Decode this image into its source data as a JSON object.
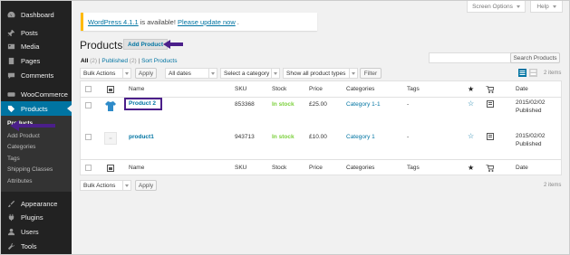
{
  "sidebar": {
    "items": [
      {
        "label": "Dashboard",
        "icon": "dashboard-icon"
      },
      {
        "label": "Posts",
        "icon": "pin-icon"
      },
      {
        "label": "Media",
        "icon": "media-icon"
      },
      {
        "label": "Pages",
        "icon": "page-icon"
      },
      {
        "label": "Comments",
        "icon": "comment-icon"
      },
      {
        "label": "WooCommerce",
        "icon": "woocommerce-icon"
      },
      {
        "label": "Products",
        "icon": "products-icon"
      },
      {
        "label": "Appearance",
        "icon": "brush-icon"
      },
      {
        "label": "Plugins",
        "icon": "plug-icon"
      },
      {
        "label": "Users",
        "icon": "user-icon"
      },
      {
        "label": "Tools",
        "icon": "wrench-icon"
      }
    ],
    "submenu": [
      "Products",
      "Add Product",
      "Categories",
      "Tags",
      "Shipping Classes",
      "Attributes"
    ]
  },
  "header": {
    "screen_options": "Screen Options",
    "help": "Help",
    "notice": {
      "prefix": "WordPress 4.1.1",
      "mid": "is available!",
      "link": "Please update now",
      "suffix": "."
    },
    "title": "Products",
    "add_new": "Add Product"
  },
  "views": {
    "all": "All",
    "all_count": "(2)",
    "published": "Published",
    "published_count": "(2)",
    "sort": "Sort Products",
    "sep": "|"
  },
  "search": {
    "button": "Search Products",
    "value": ""
  },
  "filters": {
    "bulk_actions": "Bulk Actions",
    "apply": "Apply",
    "dates": "All dates",
    "category": "Select a category",
    "product_types": "Show all product types",
    "filter": "Filter"
  },
  "items_count": "2 items",
  "columns": {
    "name": "Name",
    "sku": "SKU",
    "stock": "Stock",
    "price": "Price",
    "categories": "Categories",
    "tags": "Tags",
    "date": "Date"
  },
  "rows": [
    {
      "name": "Product 2",
      "sku": "853368",
      "stock": "In stock",
      "price": "£25.00",
      "category": "Category 1-1",
      "tags": "-",
      "date": "2015/02/02",
      "status": "Published"
    },
    {
      "name": "product1",
      "sku": "943713",
      "stock": "In stock",
      "price": "£10.00",
      "category": "Category 1",
      "tags": "-",
      "date": "2015/02/02",
      "status": "Published"
    }
  ],
  "colors": {
    "sidebar": "#222222",
    "active": "#0074a2",
    "link": "#0074a2",
    "annotation": "#4b1f8a",
    "instock": "#7ad03a"
  }
}
